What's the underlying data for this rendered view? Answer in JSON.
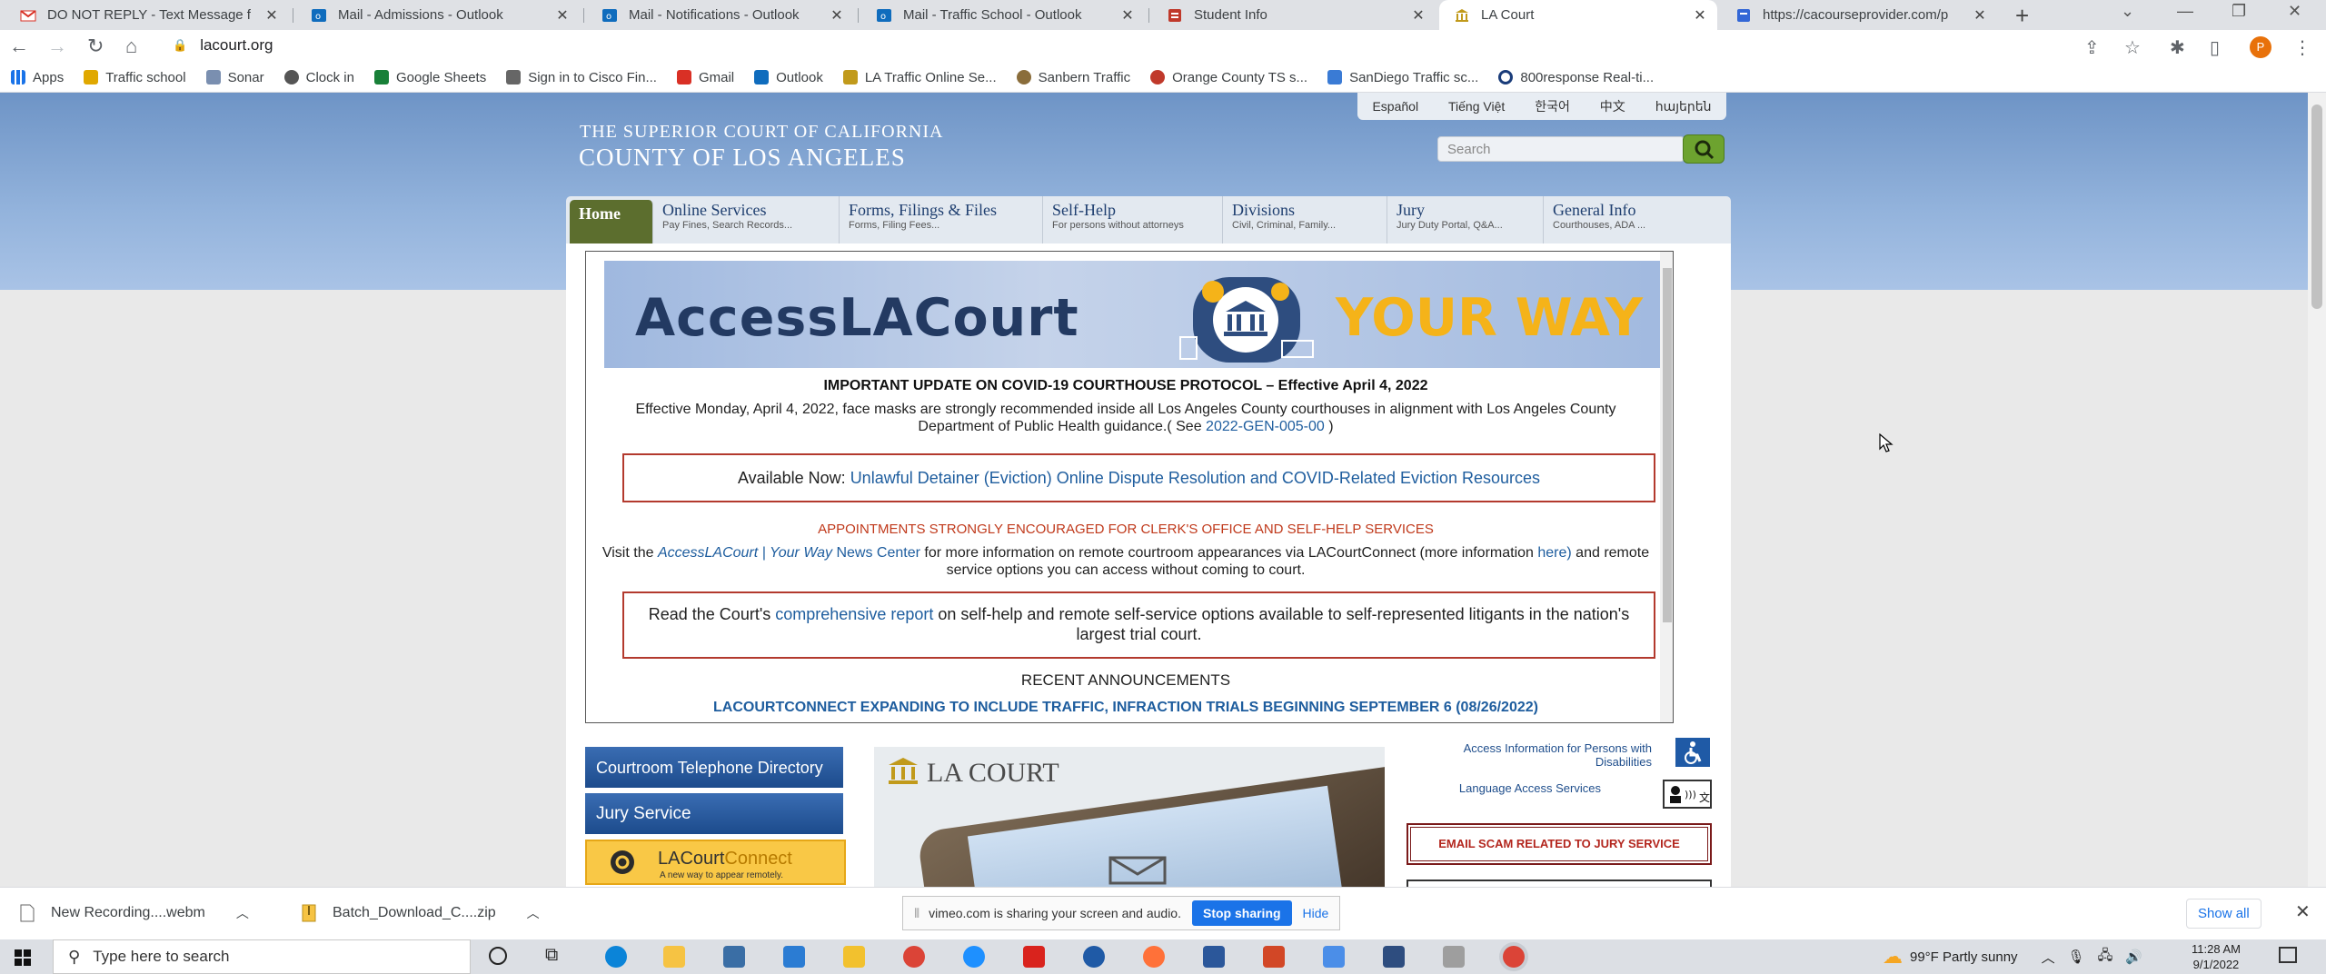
{
  "tabs": [
    {
      "title": "DO NOT REPLY - Text Message f",
      "icon": "gmail-icon",
      "color": "#d93025"
    },
    {
      "title": "Mail - Admissions - Outlook",
      "icon": "outlook-icon",
      "color": "#0f6cbd"
    },
    {
      "title": "Mail - Notifications - Outlook",
      "icon": "outlook-icon",
      "color": "#0f6cbd"
    },
    {
      "title": "Mail - Traffic School - Outlook",
      "icon": "outlook-icon",
      "color": "#0f6cbd"
    },
    {
      "title": "Student Info",
      "icon": "page-icon",
      "color": "#c0392b"
    },
    {
      "title": "LA Court",
      "icon": "courthouse-icon",
      "color": "#c19a1b"
    },
    {
      "title": "https://cacourseprovider.com/p",
      "icon": "page-icon",
      "color": "#3367d6"
    }
  ],
  "address": {
    "url": "lacourt.org"
  },
  "profile_initial": "P",
  "bookmarks": [
    {
      "label": "Apps",
      "color": "#1a73e8"
    },
    {
      "label": "Traffic school",
      "color": "#e0a800"
    },
    {
      "label": "Sonar",
      "color": "#7a8fb0"
    },
    {
      "label": "Clock in",
      "color": "#555555"
    },
    {
      "label": "Google Sheets",
      "color": "#188038"
    },
    {
      "label": "Sign in to Cisco Fin...",
      "color": "#666666"
    },
    {
      "label": "Gmail",
      "color": "#d93025"
    },
    {
      "label": "Outlook",
      "color": "#0f6cbd"
    },
    {
      "label": "LA Traffic Online Se...",
      "color": "#c19a1b"
    },
    {
      "label": "Sanbern Traffic",
      "color": "#8a6d3b"
    },
    {
      "label": "Orange County TS s...",
      "color": "#c0392b"
    },
    {
      "label": "SanDiego Traffic sc...",
      "color": "#3a7bd5"
    },
    {
      "label": "800response Real-ti...",
      "color": "#1a3c7a"
    }
  ],
  "site": {
    "court_line1": "THE SUPERIOR COURT OF CALIFORNIA",
    "court_line2": "COUNTY OF LOS ANGELES",
    "languages": [
      "Español",
      "Tiếng Việt",
      "한국어",
      "中文",
      "հայերեն"
    ],
    "search_placeholder": "Search",
    "nav": [
      {
        "label": "Home",
        "sub": ""
      },
      {
        "label": "Online Services",
        "sub": "Pay Fines, Search Records..."
      },
      {
        "label": "Forms, Filings & Files",
        "sub": "Forms, Filing Fees..."
      },
      {
        "label": "Self-Help",
        "sub": "For persons without attorneys"
      },
      {
        "label": "Divisions",
        "sub": "Civil, Criminal, Family..."
      },
      {
        "label": "Jury",
        "sub": "Jury Duty Portal, Q&A..."
      },
      {
        "label": "General Info",
        "sub": "Courthouses, ADA ..."
      }
    ],
    "banner": {
      "left": "AccessLACourt",
      "right": "YOUR WAY"
    },
    "update_title": "IMPORTANT UPDATE ON COVID-19 COURTHOUSE PROTOCOL – Effective April 4, 2022",
    "update_body": "Effective Monday, April 4, 2022, face masks are strongly recommended inside all Los Angeles County courthouses in alignment with Los Angeles County Department of Public Health guidance.( See",
    "update_link": "2022-GEN-005-00",
    "update_close": " )",
    "available_prefix": "Available Now: ",
    "available_link": "Unlawful Detainer (Eviction) Online Dispute Resolution and COVID-Related Eviction Resources",
    "appointments": "APPOINTMENTS STRONGLY ENCOURAGED FOR CLERK'S OFFICE AND SELF-HELP SERVICES",
    "visit_prefix": "Visit the ",
    "visit_link": "AccessLACourt | Your Way",
    "visit_link2": " News Center",
    "visit_mid": " for more information on remote courtroom appearances via LACourtConnect (more information ",
    "visit_here": "here)",
    "visit_end": " and remote service options you can access without coming to court.",
    "report_prefix": "Read the Court's ",
    "report_link": "comprehensive report",
    "report_rest": " on self-help and remote self-service options available to self-represented litigants in the nation's largest trial court.",
    "recent": "RECENT ANNOUNCEMENTS",
    "announcement": "LACOURTCONNECT EXPANDING TO INCLUDE TRAFFIC, INFRACTION TRIALS BEGINNING SEPTEMBER 6 (08/26/2022)",
    "left_buttons": [
      "Courtroom Telephone Directory",
      "Jury Service"
    ],
    "lacc_a": "LACourt",
    "lacc_b": "Connect",
    "lacc_tag": "A new way to appear remotely.",
    "mid_heading": "LA COURT",
    "access_info": "Access Information for Persons with Disabilities",
    "language_access": "Language Access Services",
    "scam": "EMAIL SCAM RELATED TO JURY SERVICE"
  },
  "downloads": [
    {
      "name": "New Recording....webm"
    },
    {
      "name": "Batch_Download_C....zip"
    }
  ],
  "sharing": {
    "text": "vimeo.com is sharing your screen and audio.",
    "stop": "Stop sharing",
    "hide": "Hide"
  },
  "show_all": "Show all",
  "taskbar": {
    "search_placeholder": "Type here to search",
    "weather": "99°F  Partly sunny",
    "time": "11:28 AM",
    "date": "9/1/2022"
  }
}
